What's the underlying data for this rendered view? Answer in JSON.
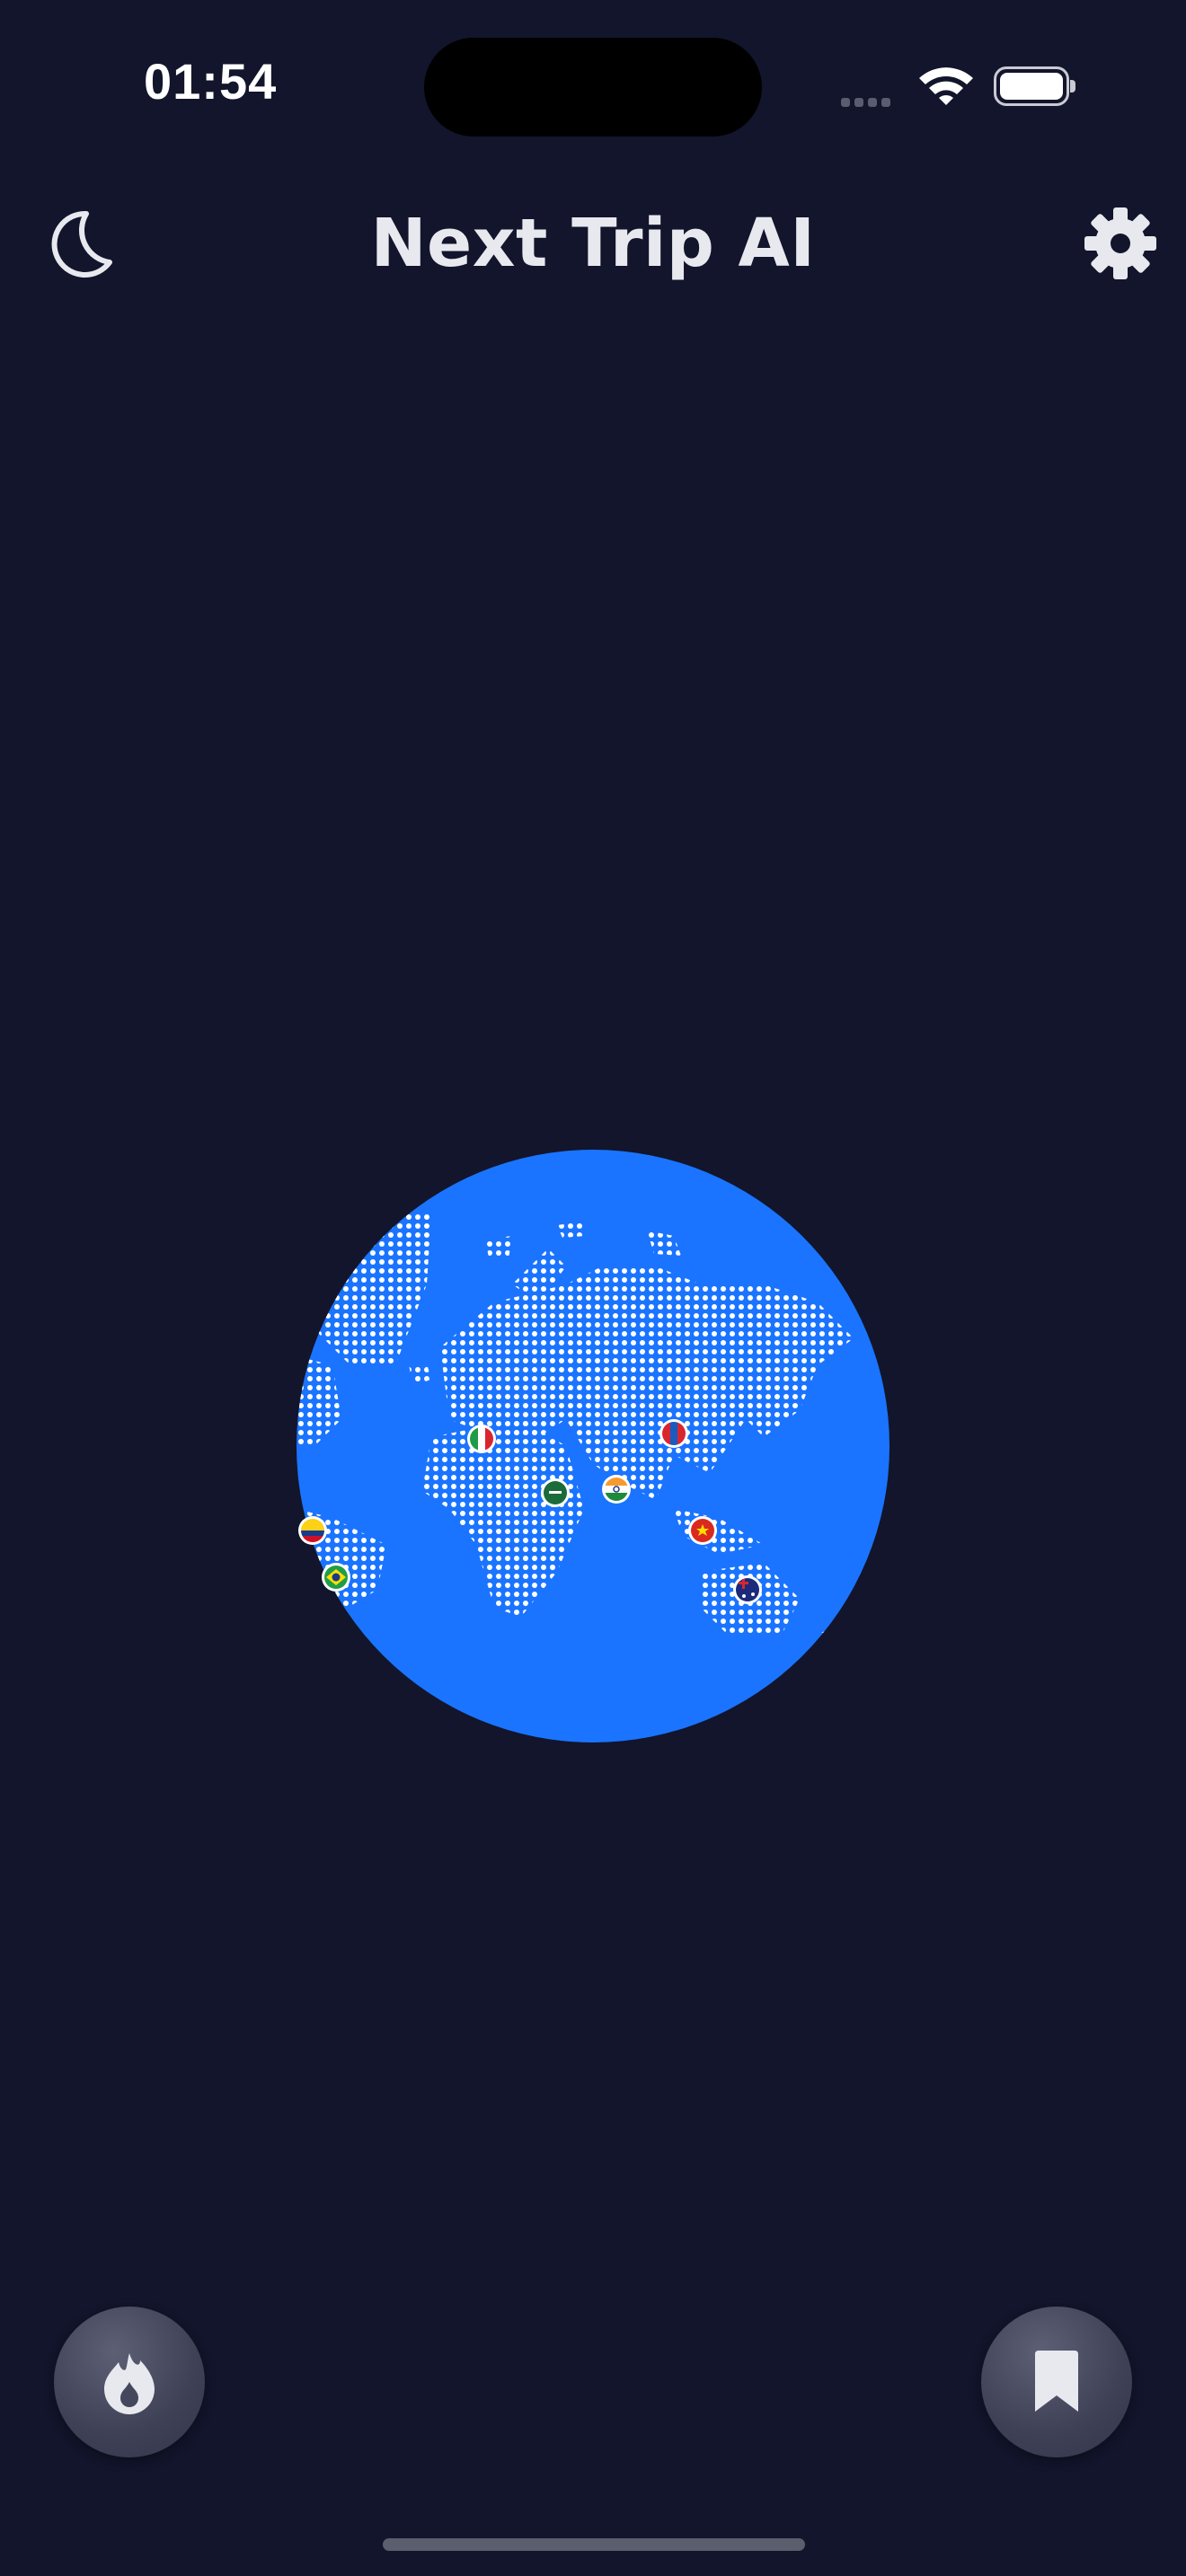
{
  "status_bar": {
    "time": "01:54"
  },
  "header": {
    "title": "Next Trip AI",
    "left_icon": "moon-icon",
    "right_icon": "gear-icon"
  },
  "globe": {
    "ocean_color": "#1a74ff",
    "land_dot_color": "#ffffff",
    "flag_markers": [
      "Italy",
      "Mongolia",
      "Saudi Arabia",
      "India",
      "Vietnam",
      "Australia",
      "Colombia",
      "Brazil"
    ]
  },
  "bottom_buttons": {
    "left_icon": "flame-icon",
    "right_icon": "bookmark-icon"
  },
  "colors": {
    "background": "#12152b",
    "button": "#3e4156"
  }
}
